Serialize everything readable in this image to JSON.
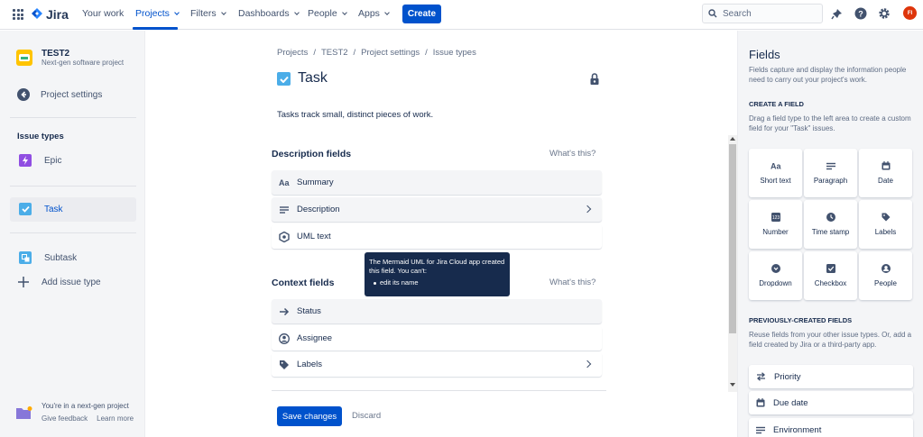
{
  "nav": {
    "logo": "Jira",
    "items": [
      "Your work",
      "Projects",
      "Filters",
      "Dashboards",
      "People",
      "Apps"
    ],
    "create": "Create",
    "search_placeholder": "Search",
    "avatar_initials": "FI"
  },
  "sidebar": {
    "project_name": "TEST2",
    "project_type": "Next-gen software project",
    "settings": "Project settings",
    "issue_types_heading": "Issue types",
    "epic": "Epic",
    "task": "Task",
    "subtask": "Subtask",
    "add_issue_type": "Add issue type",
    "footer_text": "You're in a next-gen project",
    "give_feedback": "Give feedback",
    "learn_more": "Learn more"
  },
  "main": {
    "breadcrumb": [
      "Projects",
      "/",
      "TEST2",
      "/",
      "Project settings",
      "/",
      "Issue types"
    ],
    "title": "Task",
    "description": "Tasks track small, distinct pieces of work.",
    "description_fields_heading": "Description fields",
    "context_fields_heading": "Context fields",
    "whats_this": "What's this?",
    "description_fields": [
      "Summary",
      "Description",
      "UML text"
    ],
    "context_fields": [
      "Status",
      "Assignee",
      "Labels"
    ],
    "save": "Save changes",
    "discard": "Discard"
  },
  "tooltip": {
    "text": "The Mermaid UML for Jira Cloud app created this field. You can't:",
    "bullet": "edit its name"
  },
  "right_panel": {
    "title": "Fields",
    "description": "Fields capture and display the information people need to carry out your project's work.",
    "create_heading": "CREATE A FIELD",
    "create_desc": "Drag a field type to the left area to create a custom field for your \"Task\" issues.",
    "field_types": [
      "Short text",
      "Paragraph",
      "Date",
      "Number",
      "Time stamp",
      "Labels",
      "Dropdown",
      "Checkbox",
      "People"
    ],
    "previous_heading": "PREVIOUSLY-CREATED FIELDS",
    "previous_desc": "Reuse fields from your other issue types. Or, add a field created by Jira or a third-party app.",
    "previous_fields": [
      "Priority",
      "Due date",
      "Environment"
    ]
  },
  "colors": {
    "primary": "#0052cc",
    "task_icon": "#4bade8",
    "epic_icon": "#904ee2",
    "tooltip_bg": "#172b4d"
  }
}
